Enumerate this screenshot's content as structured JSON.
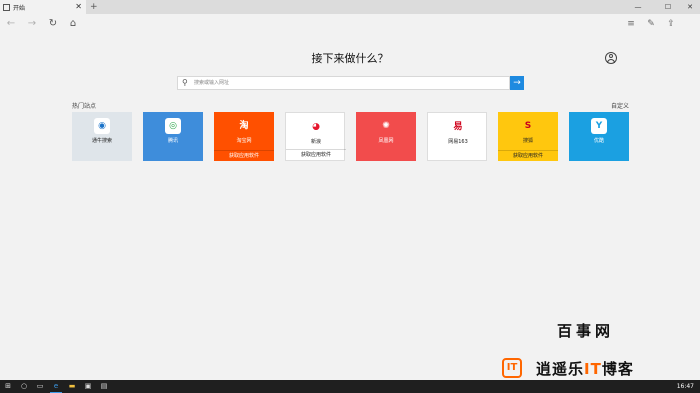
{
  "tab": {
    "title": "开始",
    "close": "✕",
    "new": "+"
  },
  "window": {
    "minimize": "—",
    "maximize": "☐",
    "close": "✕"
  },
  "nav": {
    "back": "←",
    "forward": "→",
    "refresh": "↻",
    "home": "⌂",
    "hub": "≡",
    "note": "✎",
    "share": "⇪"
  },
  "main": {
    "heading": "接下来做什么？",
    "search": {
      "placeholder": "搜索或输入网址",
      "icon": "search-icon",
      "go": "→"
    },
    "section_label": "热门站点",
    "customize": "自定义"
  },
  "tiles": [
    {
      "name": "通牛搜索",
      "sub": "",
      "bg": "#dfe5ea",
      "fg": "#222",
      "icon": "",
      "iconBg": "#ffffff",
      "iconFg": "#1a73c9",
      "iconText": "◉"
    },
    {
      "name": "腾讯",
      "sub": "",
      "bg": "#3e8ddb",
      "fg": "#ffffff",
      "icon": "",
      "iconBg": "#ffffff",
      "iconFg": "#2aa548",
      "iconText": "◎"
    },
    {
      "name": "淘宝网",
      "sub": "获取应用软件",
      "bg": "#ff5000",
      "fg": "#ffffff",
      "icon": "",
      "iconBg": "#ff5000",
      "iconFg": "#ffffff",
      "iconText": "淘"
    },
    {
      "name": "新浪",
      "sub": "获取应用软件",
      "bg": "#ffffff",
      "fg": "#222",
      "icon": "",
      "iconBg": "#ffffff",
      "iconFg": "#e6162d",
      "iconText": "◕"
    },
    {
      "name": "凤凰网",
      "sub": "",
      "bg": "#f24c4c",
      "fg": "#ffffff",
      "icon": "",
      "iconBg": "#f24c4c",
      "iconFg": "#ffffff",
      "iconText": "✺"
    },
    {
      "name": "网易163",
      "sub": "",
      "bg": "#ffffff",
      "fg": "#222",
      "icon": "",
      "iconBg": "#ffffff",
      "iconFg": "#d0021b",
      "iconText": "易"
    },
    {
      "name": "搜狐",
      "sub": "获取应用软件",
      "bg": "#ffc70e",
      "fg": "#222",
      "icon": "",
      "iconBg": "#ffc70e",
      "iconFg": "#c8001e",
      "iconText": "S"
    },
    {
      "name": "优酷",
      "sub": "",
      "bg": "#1ba0e1",
      "fg": "#ffffff",
      "icon": "",
      "iconBg": "#ffffff",
      "iconFg": "#1ba0e1",
      "iconText": "Y"
    }
  ],
  "watermark": {
    "line1": "百事网",
    "logo": "IT",
    "part1": "逍遥乐",
    "part2": "IT",
    "part3": "博客"
  },
  "taskbar": {
    "start": "⊞",
    "search": "○",
    "taskview": "▭",
    "edge": "e",
    "explorer": "▬",
    "store": "▣",
    "app": "▤",
    "clock": "16:47"
  },
  "colors": {
    "accent": "#1e8ae0",
    "taskbar": "#1f1f1f"
  }
}
